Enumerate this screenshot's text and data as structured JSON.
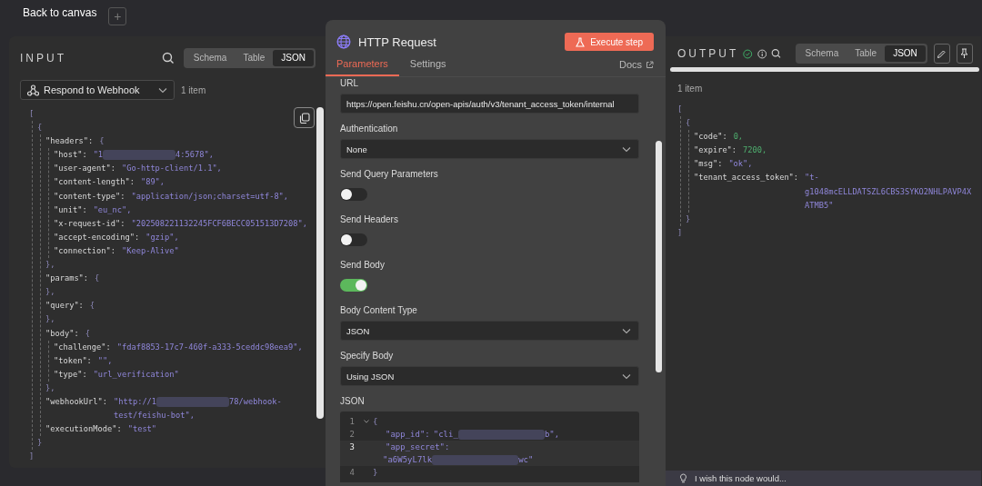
{
  "top_bar": {
    "back_link": "Back to canvas",
    "add_button": "+"
  },
  "input_panel": {
    "title": "INPUT",
    "view_tabs": [
      {
        "label": "Schema",
        "selected": false
      },
      {
        "label": "Table",
        "selected": false
      },
      {
        "label": "JSON",
        "selected": true
      }
    ],
    "source_select": {
      "value": "Respond to Webhook"
    },
    "item_count": "1 item",
    "json": [
      {
        "value": "[",
        "kind": "punct",
        "children": [
          {
            "value": "{",
            "kind": "punct",
            "children": [
              {
                "key": "\"headers\":",
                "value": "{",
                "kind": "punct",
                "children": [
                  {
                    "key": "\"host\":",
                    "value": "\"1",
                    "kind": "string",
                    "redacted": true,
                    "value_end": "4:5678\","
                  },
                  {
                    "key": "\"user-agent\":",
                    "value": "\"Go-http-client/1.1\",",
                    "kind": "string"
                  },
                  {
                    "key": "\"content-length\":",
                    "value": "\"89\",",
                    "kind": "string"
                  },
                  {
                    "key": "\"content-type\":",
                    "value": "\"application/json;charset=utf-8\",",
                    "kind": "string"
                  },
                  {
                    "key": "\"unit\":",
                    "value": "\"eu_nc\",",
                    "kind": "string"
                  },
                  {
                    "key": "\"x-request-id\":",
                    "value": "\"202508221132245FCF6BECC051513D7208\",",
                    "kind": "string"
                  },
                  {
                    "key": "\"accept-encoding\":",
                    "value": "\"gzip\",",
                    "kind": "string"
                  },
                  {
                    "key": "\"connection\":",
                    "value": "\"Keep-Alive\"",
                    "kind": "string"
                  }
                ]
              },
              {
                "value": "},",
                "kind": "punct"
              },
              {
                "key": "\"params\":",
                "value": "{",
                "kind": "punct"
              },
              {
                "value": "},",
                "kind": "punct"
              },
              {
                "key": "\"query\":",
                "value": "{",
                "kind": "punct"
              },
              {
                "value": "},",
                "kind": "punct"
              },
              {
                "key": "\"body\":",
                "value": "{",
                "kind": "punct",
                "children": [
                  {
                    "key": "\"challenge\":",
                    "value": "\"fdaf8853-17c7-460f-a333-5ceddc98eea9\",",
                    "kind": "string"
                  },
                  {
                    "key": "\"token\":",
                    "value": "\"\",",
                    "kind": "string"
                  },
                  {
                    "key": "\"type\":",
                    "value": "\"url_verification\"",
                    "kind": "string"
                  }
                ]
              },
              {
                "value": "},",
                "kind": "punct"
              },
              {
                "key": "\"webhookUrl\":",
                "value": "\"http://1",
                "kind": "string",
                "redacted": true,
                "value_end": "78/webhook-",
                "wrap": [
                  "test/feishu-bot\","
                ]
              },
              {
                "key": "\"executionMode\":",
                "value": "\"test\"",
                "kind": "string"
              }
            ]
          },
          {
            "value": "}",
            "kind": "punct"
          }
        ]
      },
      {
        "value": "]",
        "kind": "punct"
      }
    ]
  },
  "node_panel": {
    "title": "HTTP Request",
    "execute_button": "Execute step",
    "tabs": [
      {
        "label": "Parameters",
        "selected": true
      },
      {
        "label": "Settings",
        "selected": false
      }
    ],
    "docs_link": "Docs",
    "fields": [
      {
        "kind": "text",
        "label": "URL",
        "value": "https://open.feishu.cn/open-apis/auth/v3/tenant_access_token/internal"
      },
      {
        "kind": "select",
        "label": "Authentication",
        "value": "None"
      },
      {
        "kind": "toggle",
        "label": "Send Query Parameters",
        "on": false
      },
      {
        "kind": "toggle",
        "label": "Send Headers",
        "on": false
      },
      {
        "kind": "toggle",
        "label": "Send Body",
        "on": true
      },
      {
        "kind": "select",
        "label": "Body Content Type",
        "value": "JSON"
      },
      {
        "kind": "select",
        "label": "Specify Body",
        "value": "Using JSON"
      },
      {
        "kind": "code",
        "label": "JSON",
        "lines": [
          {
            "number": "1",
            "value": "{",
            "kind": "punct",
            "selected": false,
            "children": [
              {
                "number": "2",
                "key": "\"app_id\":",
                "value": "\"cli_",
                "kind": "string",
                "redacted": true,
                "value_end": "b\",",
                "selected": false
              },
              {
                "number": "3",
                "key": "\"app_secret\":",
                "selected": true,
                "wrap": [
                  {
                    "value": "\"a6W5yL7lk",
                    "kind": "string",
                    "redacted": true,
                    "value_end": "wc\""
                  }
                ]
              }
            ]
          },
          {
            "number": "4",
            "value": "}",
            "kind": "punct",
            "selected": false
          }
        ]
      }
    ]
  },
  "output_panel": {
    "title": "OUTPUT",
    "view_tabs": [
      {
        "label": "Schema",
        "selected": false
      },
      {
        "label": "Table",
        "selected": false
      },
      {
        "label": "JSON",
        "selected": true
      }
    ],
    "item_count": "1 item",
    "json": [
      {
        "value": "[",
        "kind": "punct",
        "children": [
          {
            "value": "{",
            "kind": "punct",
            "children": [
              {
                "key": "\"code\":",
                "value": "0,",
                "kind": "number"
              },
              {
                "key": "\"expire\":",
                "value": "7200,",
                "kind": "number"
              },
              {
                "key": "\"msg\":",
                "value": "\"ok\",",
                "kind": "string"
              },
              {
                "key": "\"tenant_access_token\":",
                "value": "\"t-",
                "kind": "string",
                "wrap": [
                  "g1048mcELLDATSZL6CBS3SYKO2NHLPAVP4X",
                  "ATMB5\""
                ]
              }
            ]
          },
          {
            "value": "}",
            "kind": "punct"
          }
        ]
      },
      {
        "value": "]",
        "kind": "punct"
      }
    ],
    "feedback": "I wish this node would..."
  }
}
